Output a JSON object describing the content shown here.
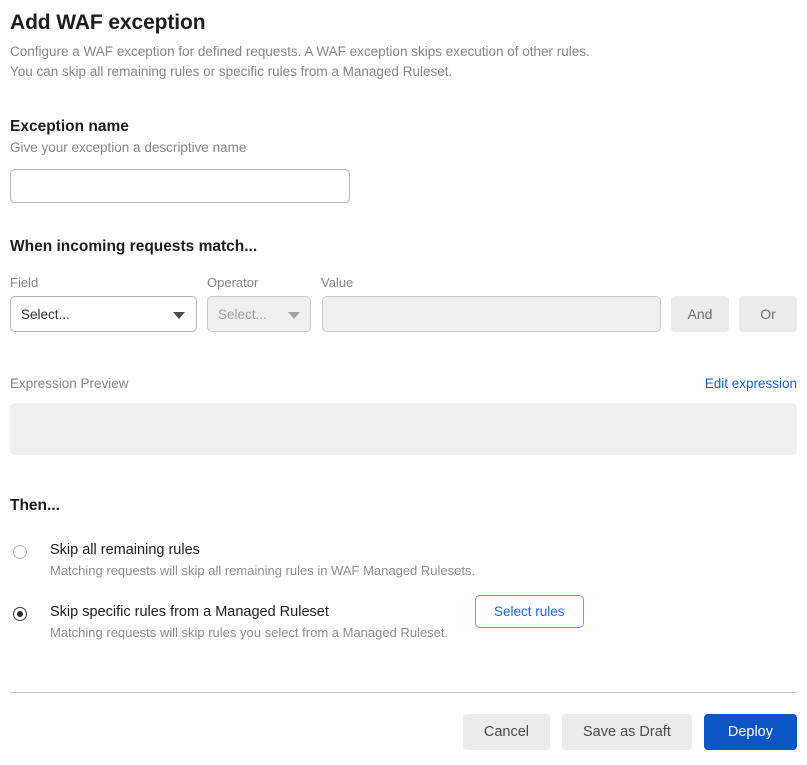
{
  "header": {
    "title": "Add WAF exception",
    "description_line1": "Configure a WAF exception for defined requests. A WAF exception skips execution of other rules.",
    "description_line2": "You can skip all remaining rules or specific rules from a Managed Ruleset."
  },
  "exception_name": {
    "title": "Exception name",
    "subtitle": "Give your exception a descriptive name",
    "value": "",
    "placeholder": ""
  },
  "match": {
    "title": "When incoming requests match...",
    "labels": {
      "field": "Field",
      "operator": "Operator",
      "value": "Value"
    },
    "field_select_value": "Select...",
    "operator_select_value": "Select...",
    "value_input": "",
    "value_placeholder": "",
    "and_label": "And",
    "or_label": "Or"
  },
  "expression": {
    "label": "Expression Preview",
    "edit_link": "Edit expression",
    "preview_text": ""
  },
  "then": {
    "title": "Then...",
    "options": [
      {
        "label": "Skip all remaining rules",
        "description": "Matching requests will skip all remaining rules in WAF Managed Rulesets.",
        "selected": false
      },
      {
        "label": "Skip specific rules from a Managed Ruleset",
        "description": "Matching requests will skip rules you select from a Managed Ruleset.",
        "selected": true
      }
    ],
    "select_rules_label": "Select rules"
  },
  "footer": {
    "cancel_label": "Cancel",
    "save_draft_label": "Save as Draft",
    "deploy_label": "Deploy"
  },
  "colors": {
    "primary_blue": "#0b55c4",
    "link_blue": "#0f62d0",
    "outline_blue": "#1668de",
    "grey_button": "#ebebeb",
    "disabled_field": "#efefef"
  }
}
